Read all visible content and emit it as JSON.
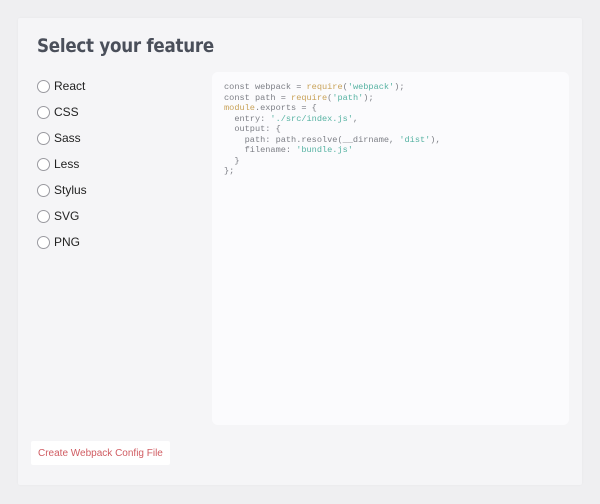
{
  "page": {
    "title": "Select your feature"
  },
  "features": [
    {
      "label": "React",
      "selected": false
    },
    {
      "label": "CSS",
      "selected": false
    },
    {
      "label": "Sass",
      "selected": false
    },
    {
      "label": "Less",
      "selected": false
    },
    {
      "label": "Stylus",
      "selected": false
    },
    {
      "label": "SVG",
      "selected": false
    },
    {
      "label": "PNG",
      "selected": false
    }
  ],
  "code_lines": [
    [
      {
        "t": "const webpack = ",
        "c": "plain"
      },
      {
        "t": "require",
        "c": "kw"
      },
      {
        "t": "(",
        "c": "plain"
      },
      {
        "t": "'webpack'",
        "c": "str"
      },
      {
        "t": ");",
        "c": "plain"
      }
    ],
    [
      {
        "t": "const path = ",
        "c": "plain"
      },
      {
        "t": "require",
        "c": "kw"
      },
      {
        "t": "(",
        "c": "plain"
      },
      {
        "t": "'path'",
        "c": "str"
      },
      {
        "t": ");",
        "c": "plain"
      }
    ],
    [
      {
        "t": "module",
        "c": "kw"
      },
      {
        "t": ".exports = {",
        "c": "plain"
      }
    ],
    [
      {
        "t": "  entry: ",
        "c": "plain"
      },
      {
        "t": "'./src/index.js'",
        "c": "str"
      },
      {
        "t": ",",
        "c": "plain"
      }
    ],
    [
      {
        "t": "  output: {",
        "c": "plain"
      }
    ],
    [
      {
        "t": "    path: path.resolve(__dirname, ",
        "c": "plain"
      },
      {
        "t": "'dist'",
        "c": "str"
      },
      {
        "t": "),",
        "c": "plain"
      }
    ],
    [
      {
        "t": "    filename: ",
        "c": "plain"
      },
      {
        "t": "'bundle.js'",
        "c": "str"
      }
    ],
    [
      {
        "t": "  }",
        "c": "plain"
      }
    ],
    [
      {
        "t": "};",
        "c": "plain"
      }
    ]
  ],
  "actions": {
    "create_label": "Create Webpack Config File"
  },
  "colors": {
    "background": "#efeff1",
    "card": "#f5f5f7",
    "code_panel": "#fbfbfd",
    "code_text": "#7d7f86",
    "code_keyword": "#c9a35a",
    "code_string": "#57b3a3",
    "button_text": "#d05c62"
  }
}
